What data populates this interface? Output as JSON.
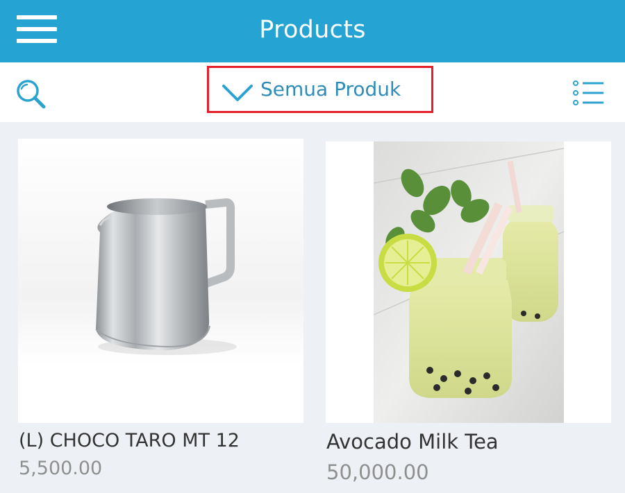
{
  "app_bar": {
    "title": "Products",
    "menu_icon": "hamburger-menu-icon"
  },
  "toolbar": {
    "search_icon": "search-icon",
    "category_label": "Semua Produk",
    "chevron_icon": "chevron-down-icon",
    "list_icon": "list-view-icon",
    "highlight_color": "#e41e2b"
  },
  "products": [
    {
      "name": "(L) CHOCO TARO MT 12",
      "price": "5,500.00",
      "image": "milk-pitcher-image"
    },
    {
      "name": "Avocado Milk Tea",
      "price": "50,000.00",
      "image": "avocado-milk-tea-image"
    }
  ],
  "colors": {
    "primary": "#25a4d4",
    "accent_text": "#2e8db8",
    "background": "#edf0f4"
  }
}
